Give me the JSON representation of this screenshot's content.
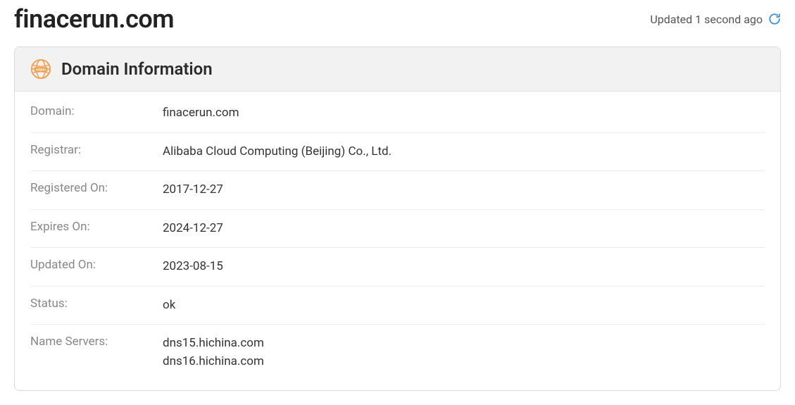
{
  "header": {
    "domain_title": "finacerun.com",
    "updated_text": "Updated 1 second ago"
  },
  "card": {
    "title": "Domain Information",
    "rows": {
      "domain": {
        "label": "Domain:",
        "value": "finacerun.com"
      },
      "registrar": {
        "label": "Registrar:",
        "value": "Alibaba Cloud Computing (Beijing) Co., Ltd."
      },
      "registered_on": {
        "label": "Registered On:",
        "value": "2017-12-27"
      },
      "expires_on": {
        "label": "Expires On:",
        "value": "2024-12-27"
      },
      "updated_on": {
        "label": "Updated On:",
        "value": "2023-08-15"
      },
      "status": {
        "label": "Status:",
        "value": "ok"
      },
      "name_servers": {
        "label": "Name Servers:",
        "values": [
          "dns15.hichina.com",
          "dns16.hichina.com"
        ]
      }
    }
  }
}
